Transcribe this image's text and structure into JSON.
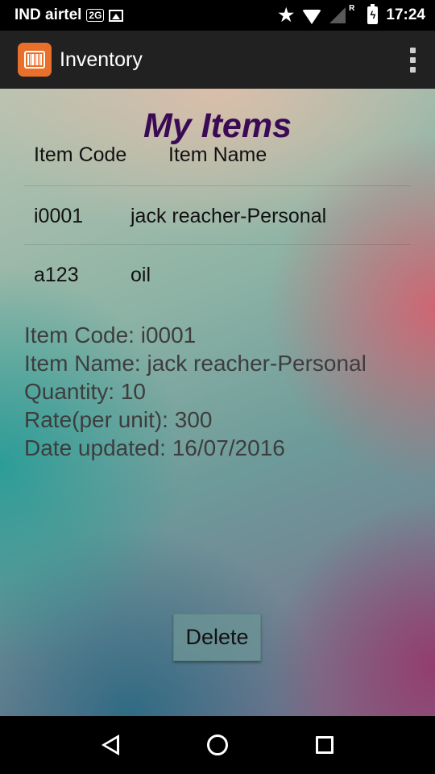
{
  "status_bar": {
    "carrier": "IND airtel",
    "badge": "2G",
    "time": "17:24",
    "roaming": "R",
    "icons": [
      "hd-badge-icon",
      "image-icon",
      "star-icon",
      "wifi-icon",
      "signal-icon",
      "battery-charging-icon"
    ]
  },
  "app_bar": {
    "title": "Inventory",
    "icon": "barcode-icon",
    "accent_color": "#e8702a",
    "menu_icon": "overflow-menu-icon"
  },
  "main": {
    "title": "My Items",
    "title_color": "#3a0a55",
    "columns": [
      "Item Code",
      "Item Name"
    ],
    "items": [
      {
        "code": "i0001",
        "name": "jack reacher-Personal"
      },
      {
        "code": "a123",
        "name": "oil"
      }
    ],
    "details": {
      "item_code": "Item Code: i0001",
      "item_name": "Item Name: jack reacher-Personal",
      "quantity": "Quantity: 10",
      "rate": "Rate(per unit): 300",
      "date_updated": "Date updated: 16/07/2016"
    },
    "delete_label": "Delete"
  },
  "nav_bar": {
    "icons": [
      "back-icon",
      "home-icon",
      "recents-icon"
    ]
  }
}
